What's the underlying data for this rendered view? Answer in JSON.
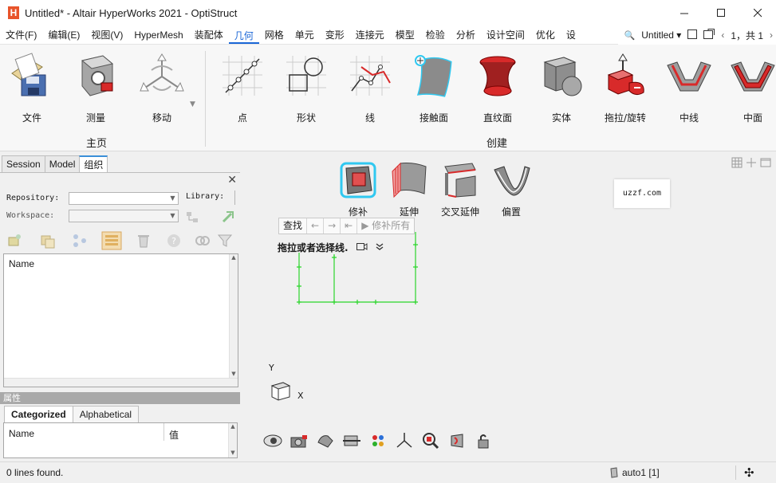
{
  "window": {
    "title": "Untitled* - Altair HyperWorks 2021 - OptiStruct",
    "logo_letter": "H",
    "min_glyph": "—",
    "max_glyph": "☐",
    "close_glyph": "✕"
  },
  "menu": {
    "items": [
      "文件(F)",
      "编辑(E)",
      "视图(V)",
      "HyperMesh",
      "装配体",
      "几何",
      "网格",
      "单元",
      "变形",
      "连接元",
      "模型",
      "检验",
      "分析",
      "设计空间",
      "优化",
      "设"
    ],
    "active_index": 5,
    "search_glyph": "🔍",
    "model_name": "Untitled",
    "page_display": "1，共 1",
    "prev_glyph": "‹",
    "next_glyph": "›"
  },
  "ribbon": {
    "home_group_title": "主页",
    "create_group_title": "创建",
    "home_tools": [
      {
        "label": "文件",
        "icon": "file-folder-icon"
      },
      {
        "label": "测量",
        "icon": "measure-icon"
      },
      {
        "label": "移动",
        "icon": "move-icon"
      }
    ],
    "create_tools": [
      {
        "label": "点",
        "icon": "points-icon"
      },
      {
        "label": "形状",
        "icon": "shape-icon"
      },
      {
        "label": "线",
        "icon": "lines-icon"
      },
      {
        "label": "接触面",
        "icon": "surface-icon"
      },
      {
        "label": "直纹面",
        "icon": "ruled-surface-icon"
      },
      {
        "label": "实体",
        "icon": "solid-icon"
      },
      {
        "label": "拖拉/旋转",
        "icon": "drag-spin-icon"
      },
      {
        "label": "中线",
        "icon": "midline-icon"
      },
      {
        "label": "中面",
        "icon": "midsurface-icon"
      }
    ]
  },
  "left_panel": {
    "tabs": [
      "Session",
      "Model",
      "组织"
    ],
    "active_tab": 2,
    "close_glyph": "✕",
    "repository_label": "Repository:",
    "workspace_label": "Workspace:",
    "library_label": "Library:",
    "list_header": "Name",
    "properties_title": "属性",
    "prop_tabs": [
      "Categorized",
      "Alphabetical"
    ],
    "prop_name_header": "Name",
    "prop_value_header": "值"
  },
  "viewport": {
    "surface_tools": [
      {
        "label": "修补",
        "icon": "patch-icon"
      },
      {
        "label": "延伸",
        "icon": "extend-icon"
      },
      {
        "label": "交叉延伸",
        "icon": "cross-extend-icon"
      },
      {
        "label": "偏置",
        "icon": "offset-icon"
      }
    ],
    "watermark": "uzzf.com",
    "find_label": "查找",
    "back_glyph": "←",
    "forward_glyph": "→",
    "first_glyph": "⇤",
    "patch_all_label": "▶ 修补所有",
    "instruction": "拖拉或者选择线.",
    "axis_y": "Y",
    "axis_x": "X"
  },
  "status": {
    "lines_found": "0 lines found.",
    "component": "auto1 [1]",
    "gear_glyph": "✣"
  },
  "colors": {
    "accent": "#1a66d6",
    "wire_green": "#2bd62b",
    "highlight_red": "#d82a2a",
    "logo_orange": "#e8542b"
  }
}
